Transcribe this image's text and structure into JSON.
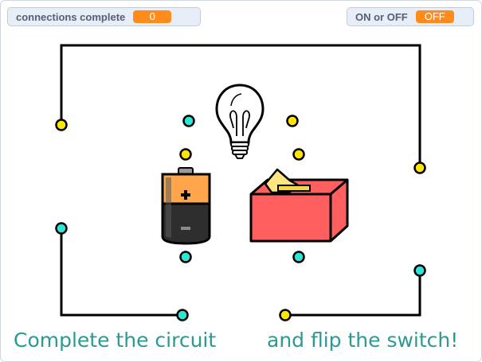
{
  "monitors": {
    "connections": {
      "label": "connections complete",
      "value": "0"
    },
    "switch": {
      "label": "ON or OFF",
      "value": "OFF"
    }
  },
  "captions": {
    "left": "Complete the circuit",
    "right": "and flip the switch!"
  },
  "colors": {
    "monitor_value_bg": "#ff8c1a",
    "caption_text": "#2b9a92",
    "terminal_yellow": "#ffe600",
    "terminal_cyan": "#2ee6d6",
    "wire": "#000000",
    "switch_body": "#ff5f5f",
    "switch_toggle": "#ffe680",
    "battery_top": "#ffa64d",
    "battery_bottom": "#2e2e2e"
  },
  "icons": {
    "bulb": "light-bulb-icon",
    "battery": "battery-icon",
    "switch": "toggle-switch-icon"
  }
}
